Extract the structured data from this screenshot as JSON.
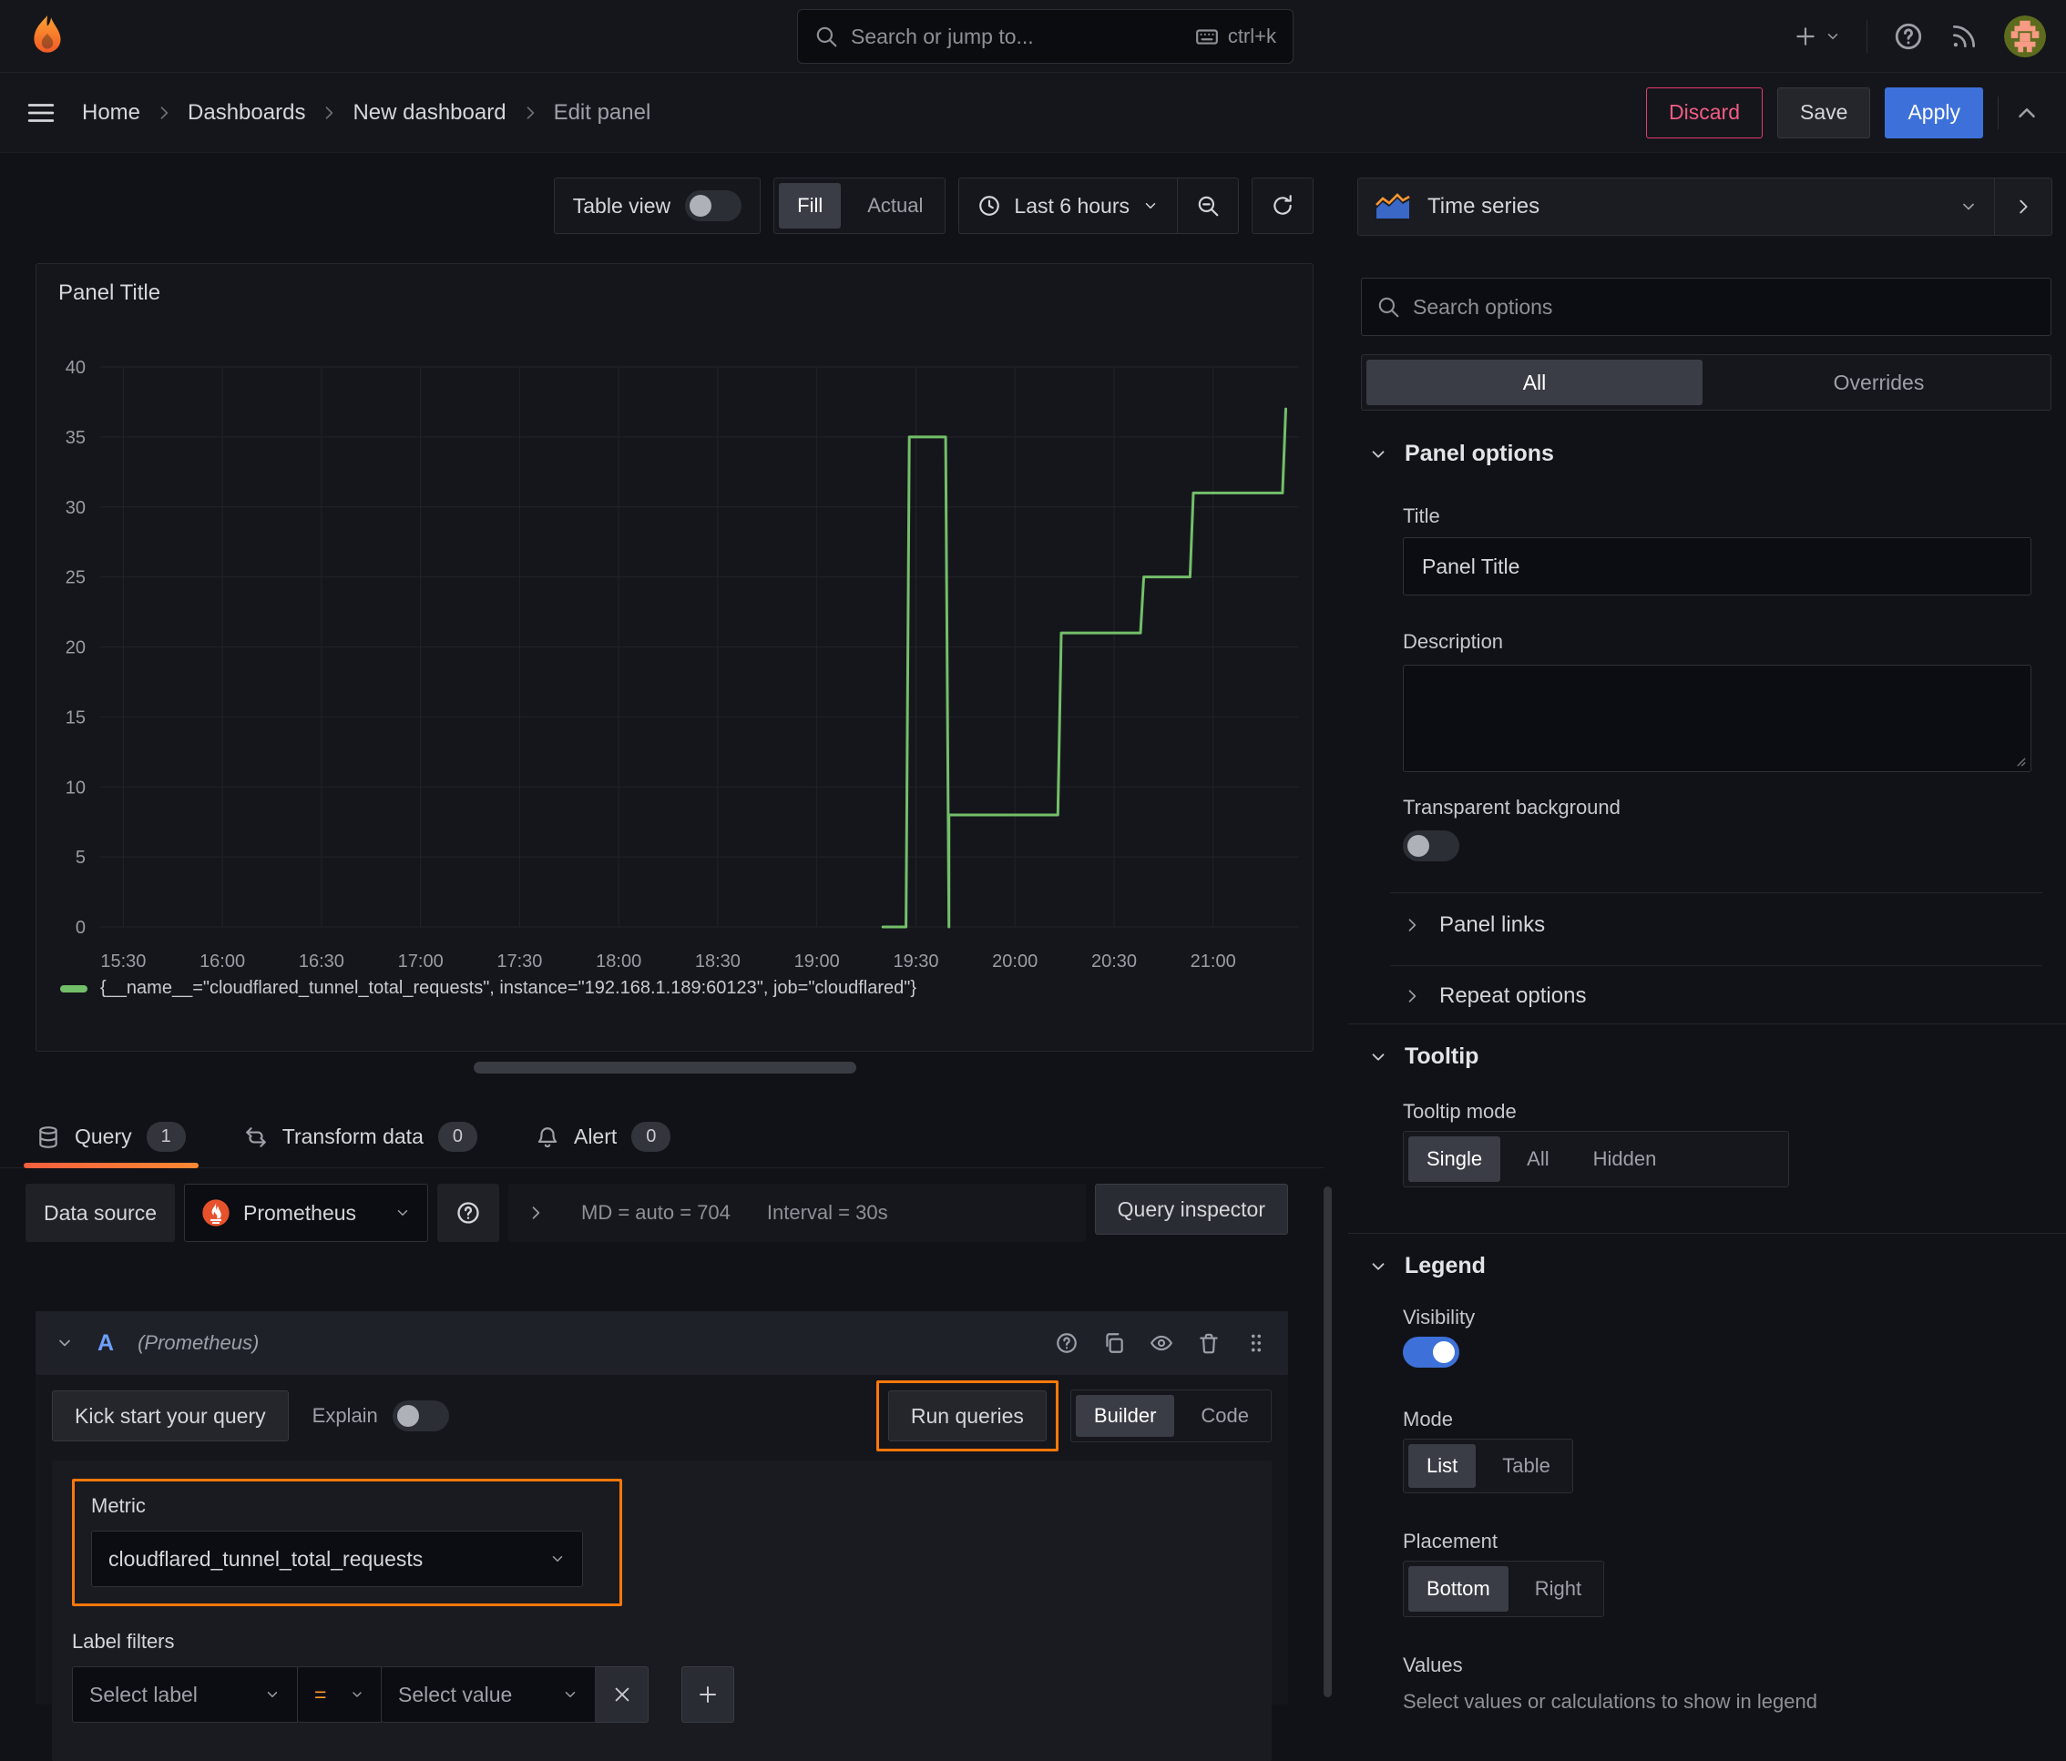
{
  "topnav": {
    "search_placeholder": "Search or jump to...",
    "shortcut": "ctrl+k"
  },
  "breadcrumb": {
    "items": [
      "Home",
      "Dashboards",
      "New dashboard",
      "Edit panel"
    ]
  },
  "actions": {
    "discard": "Discard",
    "save": "Save",
    "apply": "Apply"
  },
  "toolbar": {
    "table_view": "Table view",
    "fill": "Fill",
    "actual": "Actual",
    "time_range": "Last 6 hours"
  },
  "panel": {
    "title": "Panel Title"
  },
  "chart_data": {
    "type": "line",
    "line_style": "stepped",
    "title": "Panel Title",
    "grid": true,
    "legend_position": "bottom",
    "x_range": [
      "15:23",
      "21:26"
    ],
    "x_ticks": [
      "15:30",
      "16:00",
      "16:30",
      "17:00",
      "17:30",
      "18:00",
      "18:30",
      "19:00",
      "19:30",
      "20:00",
      "20:30",
      "21:00"
    ],
    "y_ticks": [
      0,
      5,
      10,
      15,
      20,
      25,
      30,
      35,
      40
    ],
    "ylim": [
      0,
      40
    ],
    "series": [
      {
        "name": "{__name__=\"cloudflared_tunnel_total_requests\", instance=\"192.168.1.189:60123\", job=\"cloudflared\"}",
        "color": "#73bf69",
        "points": [
          [
            "19:20",
            0
          ],
          [
            "19:27",
            0
          ],
          [
            "19:28",
            35
          ],
          [
            "19:39",
            35
          ],
          [
            "19:40",
            0
          ],
          [
            "19:40",
            8
          ],
          [
            "20:13",
            8
          ],
          [
            "20:14",
            21
          ],
          [
            "20:38",
            21
          ],
          [
            "20:39",
            25
          ],
          [
            "20:53",
            25
          ],
          [
            "20:54",
            31
          ],
          [
            "21:21",
            31
          ],
          [
            "21:22",
            37
          ]
        ]
      }
    ]
  },
  "tabs": {
    "query": {
      "label": "Query",
      "count": "1"
    },
    "transform": {
      "label": "Transform data",
      "count": "0"
    },
    "alert": {
      "label": "Alert",
      "count": "0"
    }
  },
  "datasource": {
    "label": "Data source",
    "name": "Prometheus",
    "stats_md": "MD = auto = 704",
    "stats_interval": "Interval = 30s",
    "inspector": "Query inspector"
  },
  "query_row": {
    "ref_id": "A",
    "ds_hint": "(Prometheus)"
  },
  "editor": {
    "kick_start": "Kick start your query",
    "explain": "Explain",
    "run_queries": "Run queries",
    "builder": "Builder",
    "code": "Code",
    "metric_label": "Metric",
    "metric_value": "cloudflared_tunnel_total_requests",
    "label_filters": "Label filters",
    "select_label": "Select label",
    "operator": "=",
    "select_value": "Select value"
  },
  "options": {
    "viz": "Time series",
    "search_placeholder": "Search options",
    "tab_all": "All",
    "tab_overrides": "Overrides",
    "panel_options": {
      "heading": "Panel options",
      "title_label": "Title",
      "title_value": "Panel Title",
      "description_label": "Description",
      "transparent_label": "Transparent background",
      "panel_links": "Panel links",
      "repeat_options": "Repeat options"
    },
    "tooltip": {
      "heading": "Tooltip",
      "mode_label": "Tooltip mode",
      "modes": [
        "Single",
        "All",
        "Hidden"
      ]
    },
    "legend": {
      "heading": "Legend",
      "visibility_label": "Visibility",
      "mode_label": "Mode",
      "modes": [
        "List",
        "Table"
      ],
      "placement_label": "Placement",
      "placements": [
        "Bottom",
        "Right"
      ],
      "values_label": "Values",
      "values_help": "Select values or calculations to show in legend"
    }
  },
  "colors": {
    "accent_orange": "#ff780a",
    "blue": "#3d71d9",
    "green": "#73bf69",
    "pink": "#e23b6d"
  }
}
